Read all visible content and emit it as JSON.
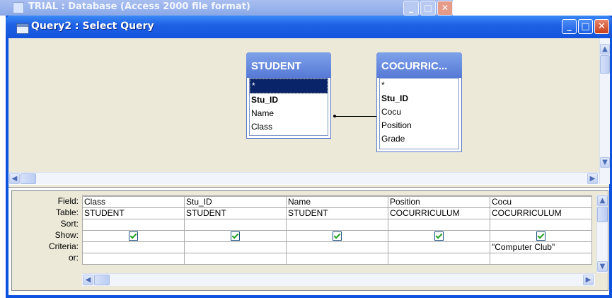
{
  "background_window": {
    "title": "TRIAL : Database (Access 2000 file format)"
  },
  "window": {
    "title": "Query2 : Select Query",
    "buttons": {
      "minimize": "_",
      "maximize": "□",
      "close": "✕"
    }
  },
  "tables": [
    {
      "name": "STUDENT",
      "fields": [
        "*",
        "Stu_ID",
        "Name",
        "Class"
      ],
      "key_fields": [
        "Stu_ID"
      ],
      "selected_field": "*"
    },
    {
      "name": "COCURRIC...",
      "fields": [
        "*",
        "Stu_ID",
        "Cocu",
        "Position",
        "Grade"
      ],
      "key_fields": [
        "Stu_ID"
      ]
    }
  ],
  "grid": {
    "row_labels": [
      "Field:",
      "Table:",
      "Sort:",
      "Show:",
      "Criteria:",
      "or:"
    ],
    "columns": [
      {
        "field": "Class",
        "table": "STUDENT",
        "sort": "",
        "show": true,
        "criteria": "",
        "or": ""
      },
      {
        "field": "Stu_ID",
        "table": "STUDENT",
        "sort": "",
        "show": true,
        "criteria": "",
        "or": ""
      },
      {
        "field": "Name",
        "table": "STUDENT",
        "sort": "",
        "show": true,
        "criteria": "",
        "or": ""
      },
      {
        "field": "Position",
        "table": "COCURRICULUM",
        "sort": "",
        "show": true,
        "criteria": "",
        "or": ""
      },
      {
        "field": "Cocu",
        "table": "COCURRICULUM",
        "sort": "",
        "show": true,
        "criteria": "\"Computer Club\"",
        "or": ""
      }
    ]
  },
  "colors": {
    "title_blue": "#1f62e6",
    "table_header": "#6a8ddf",
    "check_green": "#21a121"
  }
}
